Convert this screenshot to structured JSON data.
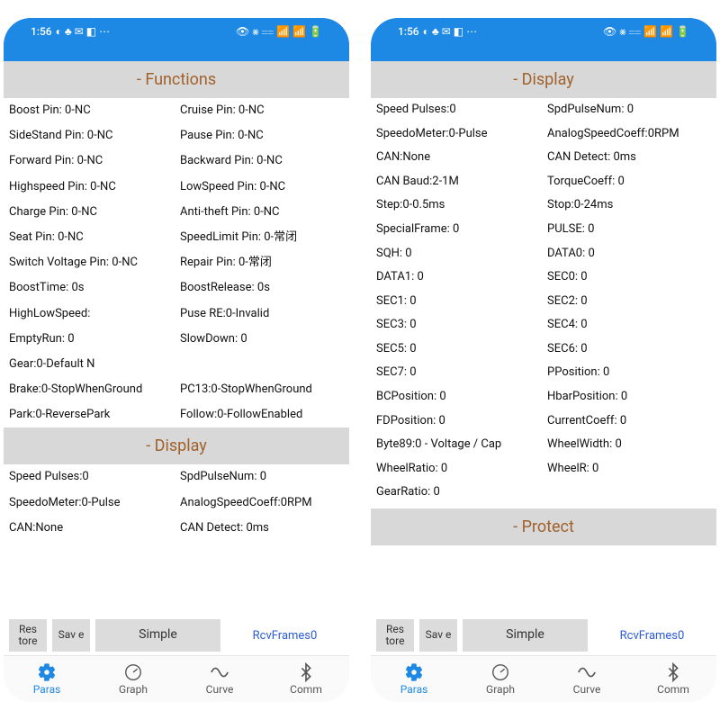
{
  "status": {
    "time": "1:56",
    "left_icons": "◐ ♣ ✉ ◧ ⋯",
    "right_icons": "👁 ⨳ ⩵ 📶 📶 🔋"
  },
  "left": {
    "section1": "- Functions",
    "rows1": [
      {
        "l": "Boost Pin: 0-NC",
        "r": "Cruise Pin: 0-NC"
      },
      {
        "l": "SideStand Pin: 0-NC",
        "r": "Pause Pin: 0-NC"
      },
      {
        "l": "Forward Pin: 0-NC",
        "r": "Backward Pin: 0-NC"
      },
      {
        "l": "Highspeed Pin: 0-NC",
        "r": "LowSpeed Pin: 0-NC"
      },
      {
        "l": "Charge Pin: 0-NC",
        "r": "Anti-theft Pin: 0-NC"
      },
      {
        "l": "Seat Pin: 0-NC",
        "r": "SpeedLimit Pin: 0-常闭"
      },
      {
        "l": "Switch Voltage Pin: 0-NC",
        "r": "Repair Pin: 0-常闭"
      },
      {
        "l": "BoostTime:   0s",
        "r": "BoostRelease:   0s"
      },
      {
        "l": "HighLowSpeed:",
        "r": "Puse RE:0-Invalid"
      },
      {
        "l": "EmptyRun:   0",
        "r": "SlowDown:   0"
      },
      {
        "l": "Gear:0-Default N",
        "r": ""
      },
      {
        "l": "Brake:0-StopWhenGround",
        "r": "PC13:0-StopWhenGround"
      },
      {
        "l": "Park:0-ReversePark",
        "r": "Follow:0-FollowEnabled"
      }
    ],
    "section2": "- Display",
    "rows2": [
      {
        "l": "Speed Pulses:0",
        "r": "SpdPulseNum:   0"
      },
      {
        "l": "SpeedoMeter:0-Pulse",
        "r": "AnalogSpeedCoeff:0RPM"
      },
      {
        "l": "CAN:None",
        "r": "CAN Detect:   0ms"
      }
    ]
  },
  "right": {
    "section1": "- Display",
    "rows1": [
      {
        "l": "Speed Pulses:0",
        "r": "SpdPulseNum:   0"
      },
      {
        "l": "SpeedoMeter:0-Pulse",
        "r": "AnalogSpeedCoeff:0RPM"
      },
      {
        "l": "CAN:None",
        "r": "CAN Detect:   0ms"
      },
      {
        "l": "CAN Baud:2-1M",
        "r": "TorqueCoeff:   0"
      },
      {
        "l": "Step:0-0.5ms",
        "r": "Stop:0-24ms"
      },
      {
        "l": "SpecialFrame:   0",
        "r": "PULSE:   0"
      },
      {
        "l": "SQH:   0",
        "r": "DATA0:   0"
      },
      {
        "l": "DATA1:   0",
        "r": "SEC0:   0"
      },
      {
        "l": "SEC1:   0",
        "r": "SEC2:   0"
      },
      {
        "l": "SEC3:   0",
        "r": "SEC4:   0"
      },
      {
        "l": "SEC5:   0",
        "r": "SEC6:   0"
      },
      {
        "l": "SEC7:   0",
        "r": "PPosition:   0"
      },
      {
        "l": "BCPosition:   0",
        "r": "HbarPosition:   0"
      },
      {
        "l": "FDPosition:   0",
        "r": "CurrentCoeff:   0"
      },
      {
        "l": "Byte89:0 - Voltage / Cap",
        "r": "WheelWidth:   0"
      },
      {
        "l": "WheelRatio:   0",
        "r": "WheelR:   0"
      },
      {
        "l": "GearRatio:   0",
        "r": ""
      }
    ],
    "section2": "- Protect"
  },
  "bottom": {
    "restore": "Res\ntore",
    "save": "Sav\ne",
    "simple": "Simple",
    "rcv": "RcvFrames0"
  },
  "tabs": {
    "paras": "Paras",
    "graph": "Graph",
    "curve": "Curve",
    "comm": "Comm"
  }
}
